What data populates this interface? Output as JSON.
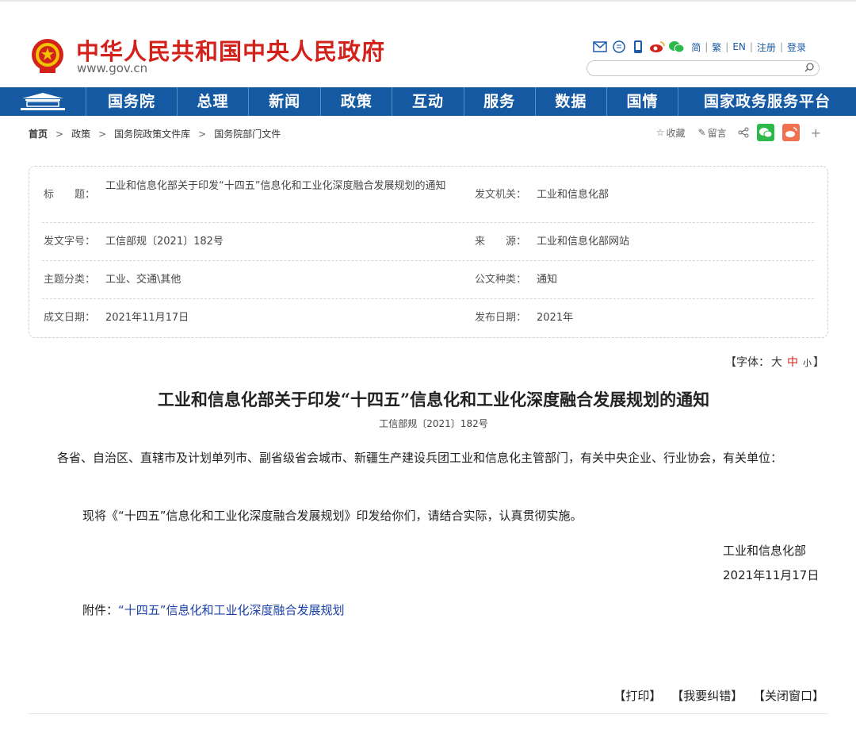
{
  "header": {
    "title": "中华人民共和国中央人民政府",
    "url": "www.gov.cn",
    "lang": {
      "simplified": "简",
      "traditional": "繁",
      "english": "EN"
    },
    "register": "注册",
    "login": "登录"
  },
  "nav": {
    "items": [
      "国务院",
      "总理",
      "新闻",
      "政策",
      "互动",
      "服务",
      "数据",
      "国情",
      "国家政务服务平台"
    ]
  },
  "breadcrumb": {
    "items": [
      "首页",
      "政策",
      "国务院政策文件库",
      "国务院部门文件"
    ]
  },
  "share": {
    "favorite": "收藏",
    "comment": "留言"
  },
  "info": {
    "title_label": "标　　题：",
    "title_value": "工业和信息化部关于印发“十四五”信息化和工业化深度融合发展规划的通知",
    "issuer_label": "发文机关：",
    "issuer_value": "工业和信息化部",
    "docno_label": "发文字号：",
    "docno_value": "工信部规〔2021〕182号",
    "source_label": "来　　源：",
    "source_value": "工业和信息化部网站",
    "topic_label": "主题分类：",
    "topic_value": "工业、交通\\其他",
    "type_label": "公文种类：",
    "type_value": "通知",
    "created_label": "成文日期：",
    "created_value": "2021年11月17日",
    "published_label": "发布日期：",
    "published_value": "2021年"
  },
  "fontsize": {
    "prefix": "【字体：",
    "big": "大",
    "mid": "中",
    "small": "小",
    "suffix": "】"
  },
  "article": {
    "title": "工业和信息化部关于印发“十四五”信息化和工业化深度融合发展规划的通知",
    "docno": "工信部规〔2021〕182号",
    "salutation": "各省、自治区、直辖市及计划单列市、副省级省会城市、新疆生产建设兵团工业和信息化主管部门，有关中央企业、行业协会，有关单位：",
    "body": "现将《“十四五”信息化和工业化深度融合发展规划》印发给你们，请结合实际，认真贯彻实施。",
    "signer": "工业和信息化部",
    "date": "2021年11月17日",
    "attachment_label": "附件：",
    "attachment_link": "“十四五”信息化和工业化深度融合发展规划"
  },
  "footer": {
    "print": "【打印】",
    "report": "【我要纠错】",
    "close": "【关闭窗口】"
  },
  "colors": {
    "brand_red": "#d3221b",
    "nav_blue": "#1659a3",
    "link_blue": "#1a3fa8",
    "wechat_green": "#2db84a",
    "weibo_orange": "#f0714f"
  }
}
